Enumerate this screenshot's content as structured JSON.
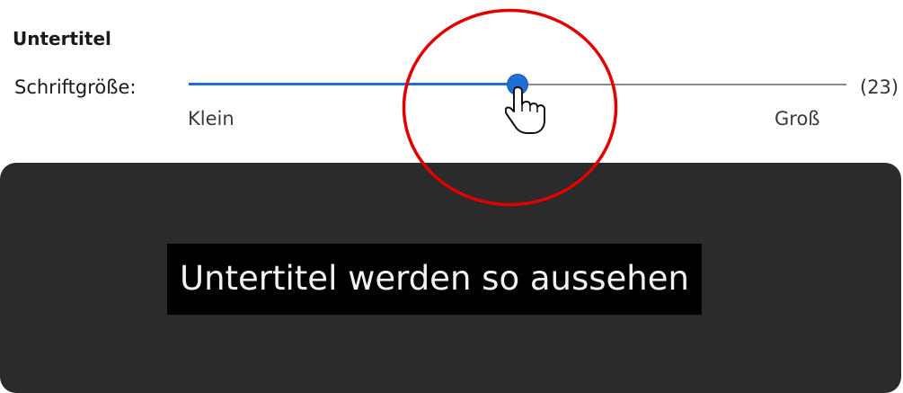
{
  "section": {
    "title": "Untertitel"
  },
  "font_size_slider": {
    "label": "Schriftgröße:",
    "value_display": "(23)",
    "min_label": "Klein",
    "max_label": "Groß",
    "level": 0.5
  },
  "preview": {
    "text": "Untertitel werden so aussehen"
  },
  "colors": {
    "accent": "#1f6fd6",
    "annotation": "#e00000",
    "preview_background": "#2b2b2b"
  },
  "icons": {
    "cursor": "hand-pointer-icon",
    "annotation": "red-highlight-circle"
  }
}
